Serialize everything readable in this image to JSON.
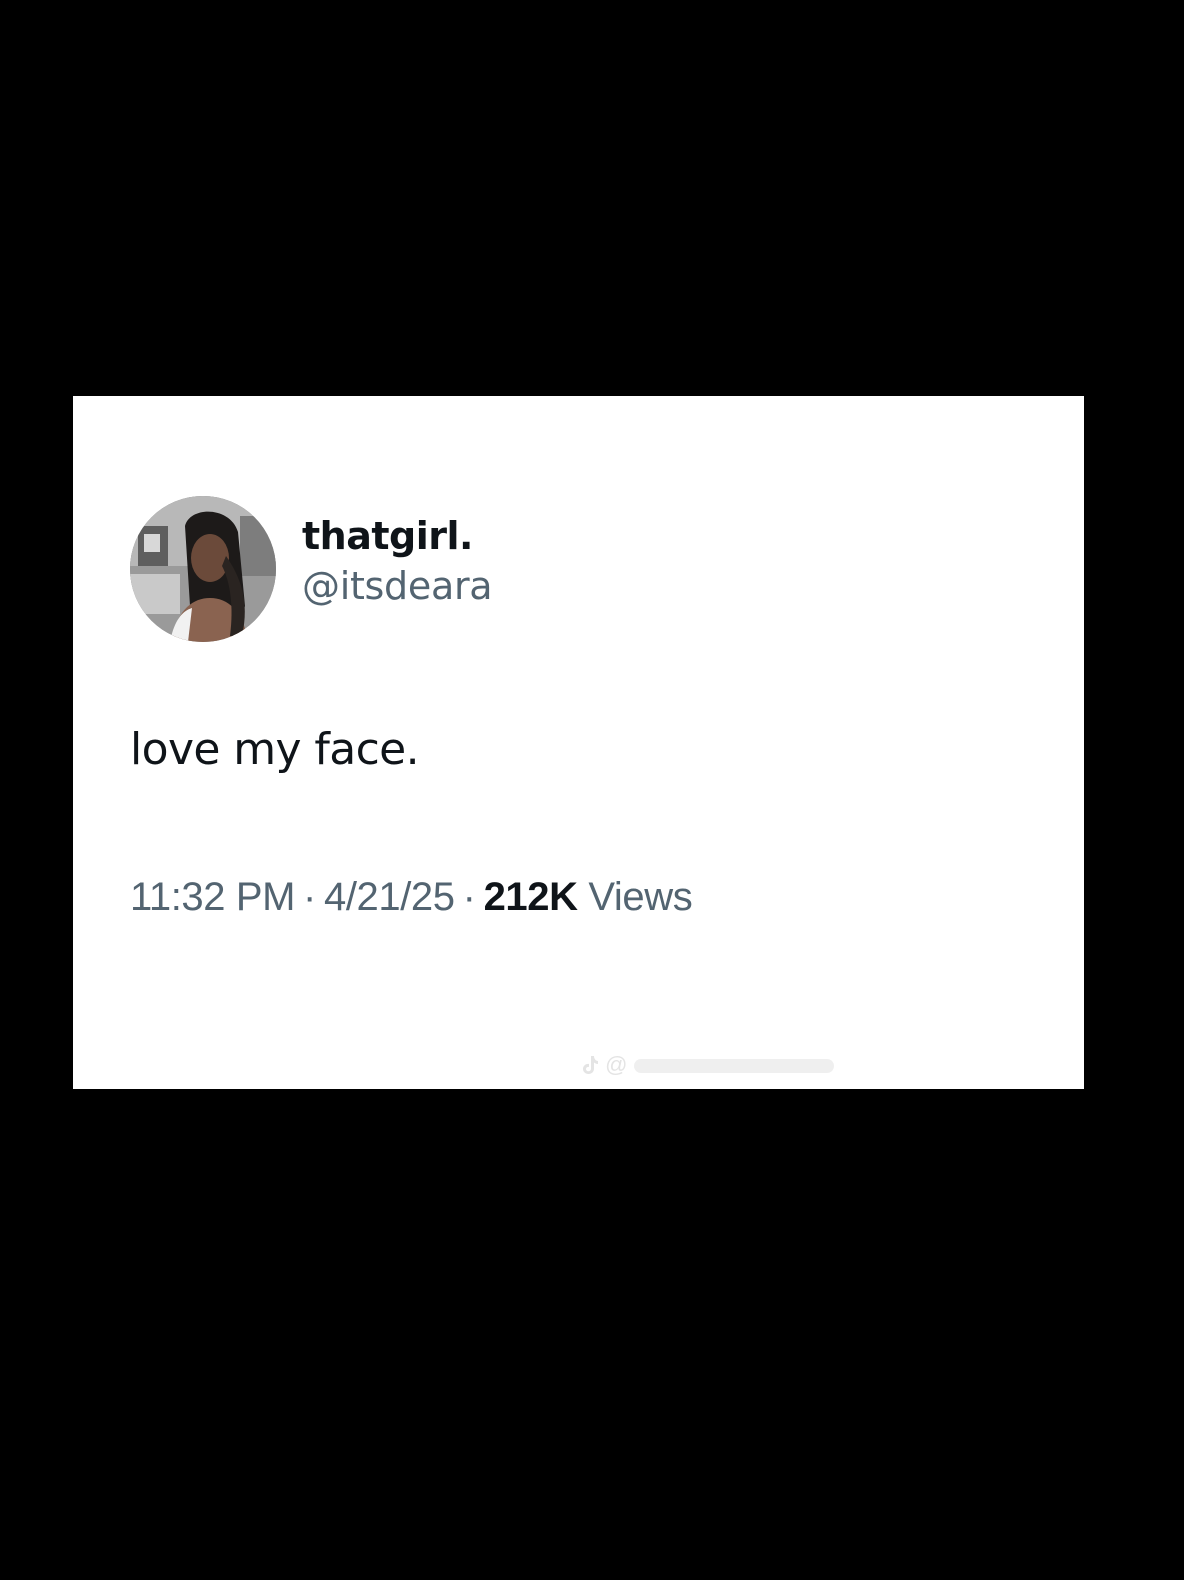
{
  "tweet": {
    "author": {
      "display_name": "thatgirl.",
      "handle": "@itsdeara",
      "avatar_icon": "profile-photo"
    },
    "text": "love my face.",
    "meta": {
      "time": "11:32 PM",
      "separator": "·",
      "date": "4/21/25",
      "views_count": "212K",
      "views_label": "Views"
    }
  },
  "watermark": {
    "icon": "tiktok-icon",
    "text": "@"
  },
  "colors": {
    "background": "#000000",
    "card": "#ffffff",
    "primary_text": "#0f1419",
    "secondary_text": "#536471"
  }
}
